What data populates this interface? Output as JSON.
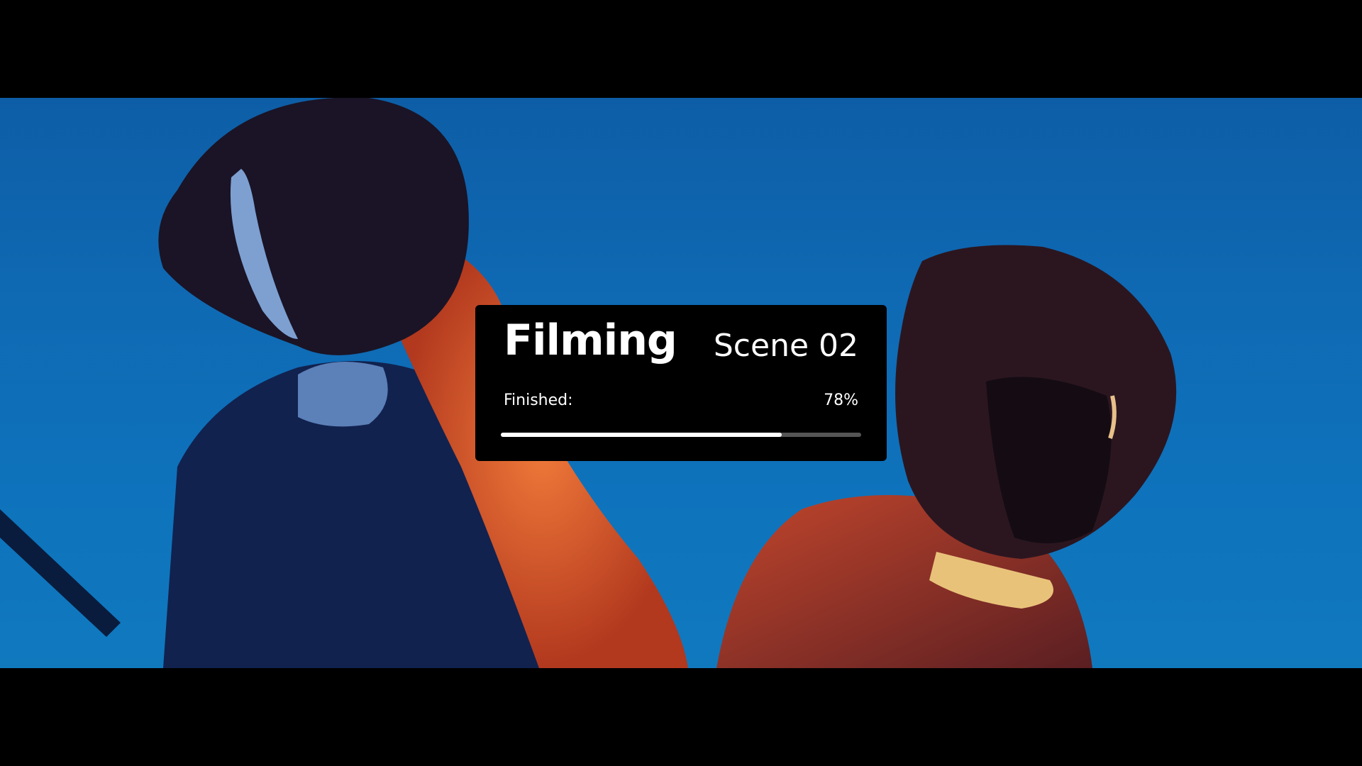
{
  "card": {
    "title": "Filming",
    "scene": "Scene 02",
    "finished_label": "Finished:",
    "finished_value": "78%",
    "progress_fraction": 0.78
  },
  "colors": {
    "sky": "#0e6db6",
    "card_background": "#000000",
    "progress_fill": "#ffffff",
    "progress_track": "#555555",
    "cape_orange": "#e0602c"
  }
}
